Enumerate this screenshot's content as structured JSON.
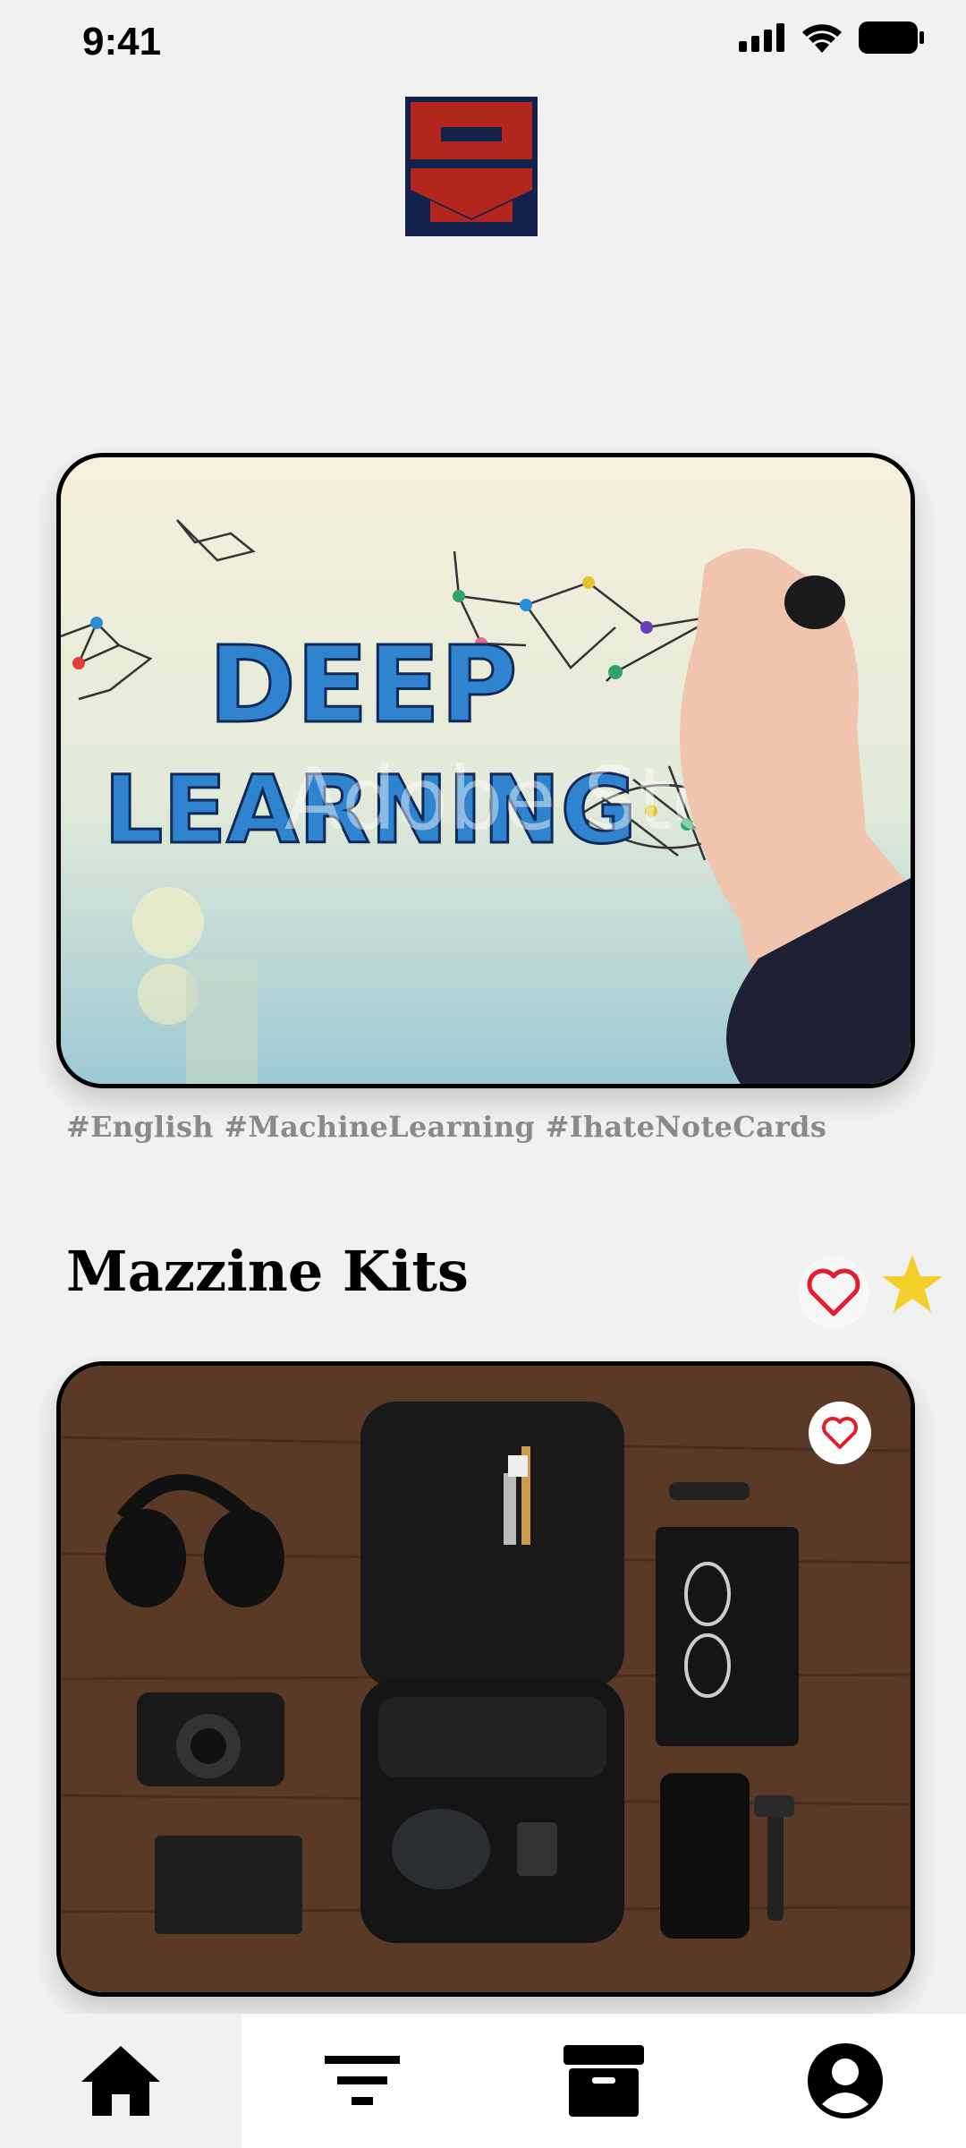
{
  "status_bar": {
    "time": "9:41"
  },
  "hero_card": {
    "image_alt": "DEEP LEARNING",
    "line1": "DEEP",
    "line2": "LEARNING",
    "watermark": "Adobe Stock"
  },
  "tags": "#English #MachineLearning #IhateNoteCards",
  "section": {
    "title": "Mazzine Kits"
  },
  "bottom_nav": [
    {
      "icon": "home-icon",
      "active": true
    },
    {
      "icon": "filter-icon",
      "active": false
    },
    {
      "icon": "archive-icon",
      "active": false
    },
    {
      "icon": "account-icon",
      "active": false
    }
  ],
  "colors": {
    "accent_red": "#e11d2e",
    "star_yellow": "#f4cf2a",
    "logo_red": "#b3261e",
    "logo_navy": "#14214d"
  }
}
